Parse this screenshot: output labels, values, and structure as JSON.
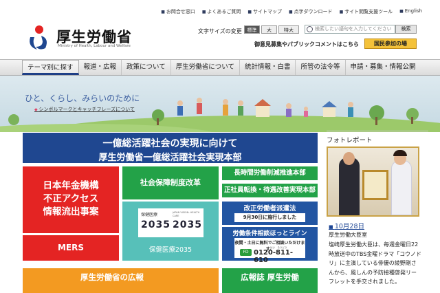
{
  "header": {
    "top_links": [
      "お問合せ窓口",
      "よくあるご質問",
      "サイトマップ",
      "点字ダウンロード",
      "サイト閲覧支援ツール",
      "English"
    ],
    "logo_title": "厚生労働省",
    "logo_en": "Ministry of Health, Labour and Welfare",
    "font_size_label": "文字サイズの変更",
    "font_sizes": [
      "標準",
      "大",
      "特大"
    ],
    "search_placeholder": "検索したい語句を入力してください",
    "search_button": "検索",
    "public_comment": "御意見募集やパブリックコメントはこちら",
    "kokumin_button": "国民参加の場"
  },
  "nav": [
    "テーマ別に探す",
    "報道・広報",
    "政策について",
    "厚生労働省について",
    "統計情報・白書",
    "所管の法令等",
    "申請・募集・情報公開"
  ],
  "hero": {
    "tagline": "ひと、くらし、みらいのために",
    "link": "シンボルマークとキャッチフレーズについて"
  },
  "main_banner": {
    "line1": "一億総活躍社会の実現に向けて",
    "line2": "厚生労働省一億総活躍社会実現本部"
  },
  "tiles": {
    "pension": [
      "日本年金機構",
      "不正アクセス",
      "情報流出事案"
    ],
    "mers": "MERS",
    "social_security": "社会保障制度改革",
    "hoken": {
      "jp": "保健医療",
      "num": "2035",
      "en": "JAPAN VISION: HEALTH CARE",
      "label": "保健医療2035"
    },
    "long_hours": "長時間労働削減推進本部",
    "regular": "正社員転換・待遇改善実現本部",
    "dispatch": {
      "title": "改正労働者派遣法",
      "sub": "9月30日に施行しました"
    },
    "hotline": {
      "title": "労働条件相談ほっとライン",
      "sub": "夜間・土日に無料でご相談いただけます。",
      "kana": "はい　ろうどう",
      "free_dial": "0120-811-610",
      "fd": "FD"
    },
    "koho": "厚生労働省の広報",
    "magazine": "広報誌 厚生労働"
  },
  "photo_report": {
    "heading": "フォトレポート",
    "date": "10月28日",
    "title": "厚生労働大臣室",
    "body": "塩崎厚生労働大臣は、毎週金曜日22時放送中のTBS金曜ドラマ「コウノドリ」に主演している俳優の綾野剛さんから、風しんの予防接種啓発リーフレットを手交されました。"
  },
  "colors": {
    "navy": "#1f4790",
    "red": "#e42423",
    "green": "#23a248",
    "teal": "#57c0b9",
    "blue": "#2255a2",
    "orange": "#f39a21",
    "yellow": "#f4c23a"
  }
}
